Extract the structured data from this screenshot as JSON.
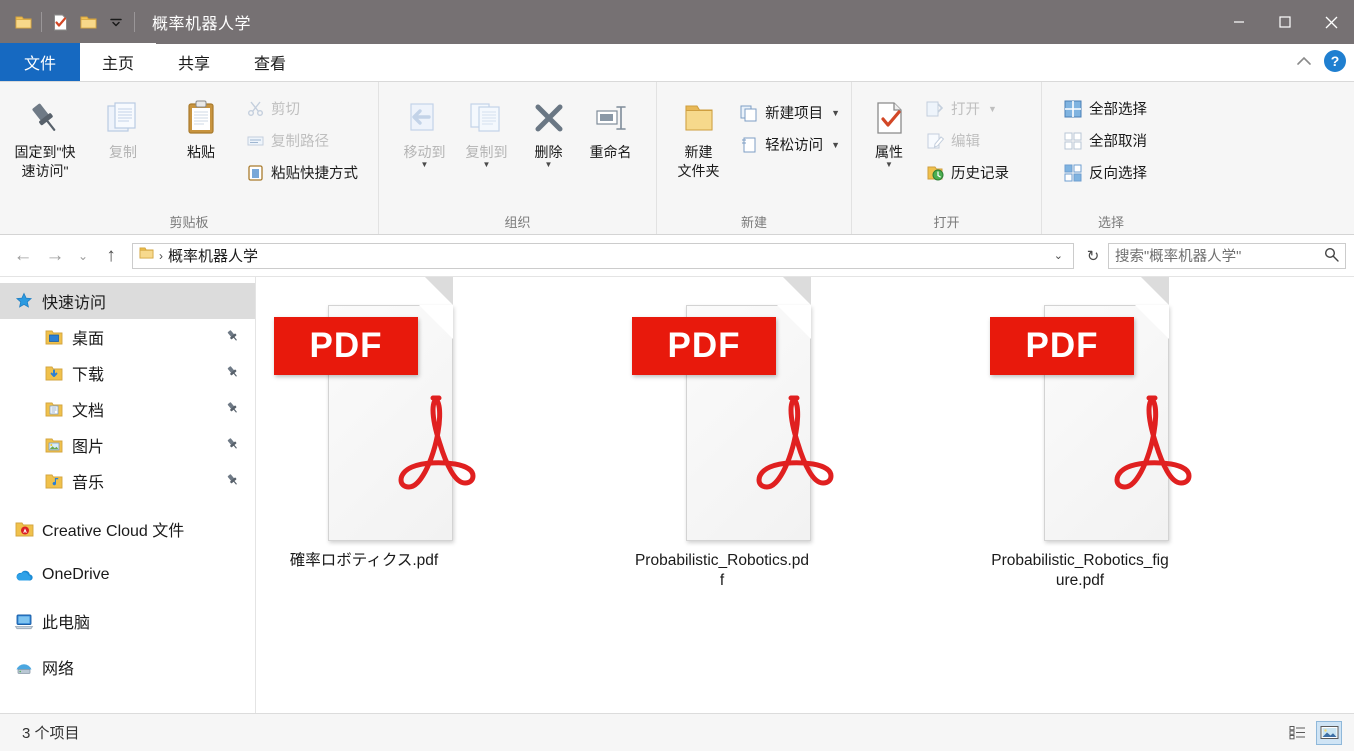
{
  "window": {
    "title": "概率机器人学",
    "quick_access": [
      {
        "name": "folder-icon",
        "label": "属性"
      },
      {
        "name": "properties-icon",
        "label": "属性"
      },
      {
        "name": "new-folder-icon",
        "label": "新建文件夹"
      },
      {
        "name": "customize-caret-icon",
        "label": "自定义快速访问工具栏"
      }
    ],
    "controls": {
      "minimize": "—",
      "maximize": "☐",
      "close": "✕"
    }
  },
  "tabs": [
    {
      "label": "文件",
      "kind": "file"
    },
    {
      "label": "主页",
      "kind": "active"
    },
    {
      "label": "共享",
      "kind": "normal"
    },
    {
      "label": "查看",
      "kind": "normal"
    }
  ],
  "tabstrip_right": {
    "collapse": "⌃",
    "help": "?"
  },
  "ribbon": {
    "groups": [
      {
        "title": "剪贴板",
        "big": [
          {
            "label": "固定到“快\n速访问”",
            "label_line1": "固定到\"快",
            "label_line2": "速访问\"",
            "icon": "pin-icon",
            "disabled": false
          },
          {
            "label": "复制",
            "icon": "copy-icon",
            "disabled": true
          },
          {
            "label": "粘贴",
            "icon": "paste-icon",
            "disabled": false
          }
        ],
        "small": [
          {
            "label": "剪切",
            "icon": "scissors-icon",
            "disabled": true
          },
          {
            "label": "复制路径",
            "icon": "copy-path-icon",
            "disabled": true
          },
          {
            "label": "粘贴快捷方式",
            "icon": "paste-shortcut-icon",
            "disabled": false
          }
        ]
      },
      {
        "title": "组织",
        "big": [
          {
            "label": "移动到",
            "icon": "move-to-icon",
            "disabled": true,
            "caret": true
          },
          {
            "label": "复制到",
            "icon": "copy-to-icon",
            "disabled": true,
            "caret": true
          },
          {
            "label": "删除",
            "icon": "delete-icon",
            "disabled": false,
            "caret": true
          },
          {
            "label": "重命名",
            "icon": "rename-icon",
            "disabled": false
          }
        ]
      },
      {
        "title": "新建",
        "big": [
          {
            "label_line1": "新建",
            "label_line2": "文件夹",
            "icon": "new-folder-icon",
            "disabled": false
          }
        ],
        "small": [
          {
            "label": "新建项目",
            "icon": "new-item-icon",
            "disabled": false,
            "caret": true
          },
          {
            "label": "轻松访问",
            "icon": "easy-access-icon",
            "disabled": false,
            "caret": true
          }
        ]
      },
      {
        "title": "打开",
        "big": [
          {
            "label": "属性",
            "icon": "properties-icon",
            "disabled": false,
            "caret": true
          }
        ],
        "small": [
          {
            "label": "打开",
            "icon": "open-icon",
            "disabled": true,
            "caret": true
          },
          {
            "label": "编辑",
            "icon": "edit-icon",
            "disabled": true
          },
          {
            "label": "历史记录",
            "icon": "history-icon",
            "disabled": false
          }
        ]
      },
      {
        "title": "选择",
        "small": [
          {
            "label": "全部选择",
            "icon": "select-all-icon",
            "disabled": false
          },
          {
            "label": "全部取消",
            "icon": "select-none-icon",
            "disabled": false
          },
          {
            "label": "反向选择",
            "icon": "invert-selection-icon",
            "disabled": false
          }
        ]
      }
    ]
  },
  "addressbar": {
    "back": "←",
    "forward": "→",
    "recent": "⌄",
    "up": "↑",
    "crumb": "概率机器人学",
    "separator": "›",
    "dropdown": "⌄",
    "refresh": "↻"
  },
  "search": {
    "placeholder": "搜索\"概率机器人学\"",
    "icon": "search-icon"
  },
  "sidebar": {
    "items": [
      {
        "label": "快速访问",
        "icon": "star-icon",
        "selected": true,
        "indent": false,
        "pinned": false
      },
      {
        "label": "桌面",
        "icon": "desktop-folder-icon",
        "selected": false,
        "indent": true,
        "pinned": true
      },
      {
        "label": "下载",
        "icon": "downloads-folder-icon",
        "selected": false,
        "indent": true,
        "pinned": true
      },
      {
        "label": "文档",
        "icon": "documents-folder-icon",
        "selected": false,
        "indent": true,
        "pinned": true
      },
      {
        "label": "图片",
        "icon": "pictures-folder-icon",
        "selected": false,
        "indent": true,
        "pinned": true
      },
      {
        "label": "音乐",
        "icon": "music-folder-icon",
        "selected": false,
        "indent": true,
        "pinned": true
      },
      {
        "label": "Creative Cloud 文件",
        "icon": "creative-cloud-icon",
        "selected": false,
        "indent": false,
        "pinned": false
      },
      {
        "label": "OneDrive",
        "icon": "onedrive-icon",
        "selected": false,
        "indent": false,
        "pinned": false
      },
      {
        "label": "此电脑",
        "icon": "this-pc-icon",
        "selected": false,
        "indent": false,
        "pinned": false
      },
      {
        "label": "网络",
        "icon": "network-icon",
        "selected": false,
        "indent": false,
        "pinned": false
      }
    ],
    "pin_glyph": "📌"
  },
  "files": [
    {
      "name": "確率ロボティクス.pdf",
      "type": "pdf",
      "badge": "PDF"
    },
    {
      "name": "Probabilistic_Robotics.pdf",
      "type": "pdf",
      "badge": "PDF"
    },
    {
      "name": "Probabilistic_Robotics_figure.pdf",
      "type": "pdf",
      "badge": "PDF"
    }
  ],
  "statusbar": {
    "count_text": "3 个项目",
    "views": [
      {
        "name": "details-view",
        "active": false
      },
      {
        "name": "large-icons-view",
        "active": true
      }
    ]
  },
  "colors": {
    "titlebar": "#767173",
    "file_tab": "#1669c1",
    "pdf_red": "#e8190c",
    "accent_blue": "#1f7fd0",
    "selection": "#dcdcdc"
  }
}
